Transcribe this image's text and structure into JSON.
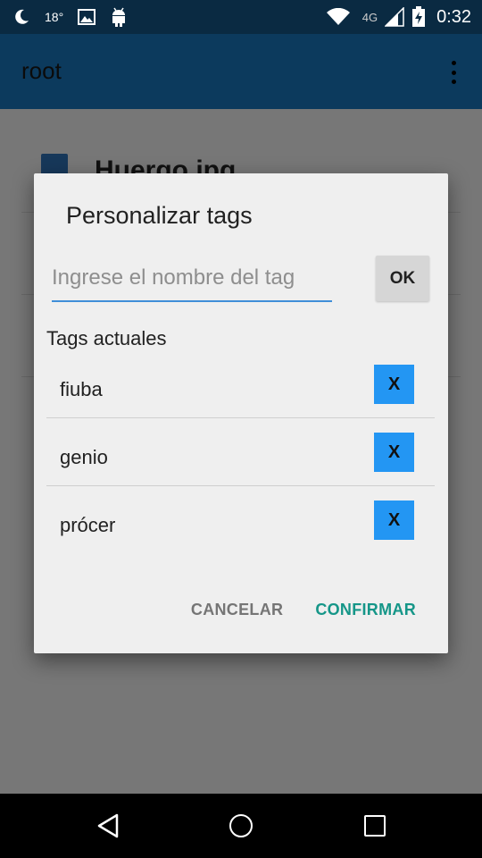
{
  "status_bar": {
    "temperature": "18°",
    "network": "4G",
    "time": "0:32"
  },
  "app_bar": {
    "title": "root"
  },
  "background": {
    "file_name": "Huergo.jpg"
  },
  "dialog": {
    "title": "Personalizar tags",
    "input_placeholder": "Ingrese el nombre del tag",
    "input_value": "",
    "ok_label": "OK",
    "tags_label": "Tags actuales",
    "remove_label": "X",
    "tags": [
      {
        "name": "fiuba"
      },
      {
        "name": "genio"
      },
      {
        "name": "prócer"
      }
    ],
    "cancel_label": "CANCELAR",
    "confirm_label": "CONFIRMAR"
  },
  "colors": {
    "accent": "#159688",
    "remove_button": "#2396f3",
    "input_underline": "#3f8ed8",
    "app_bar": "#0c3a5d"
  }
}
